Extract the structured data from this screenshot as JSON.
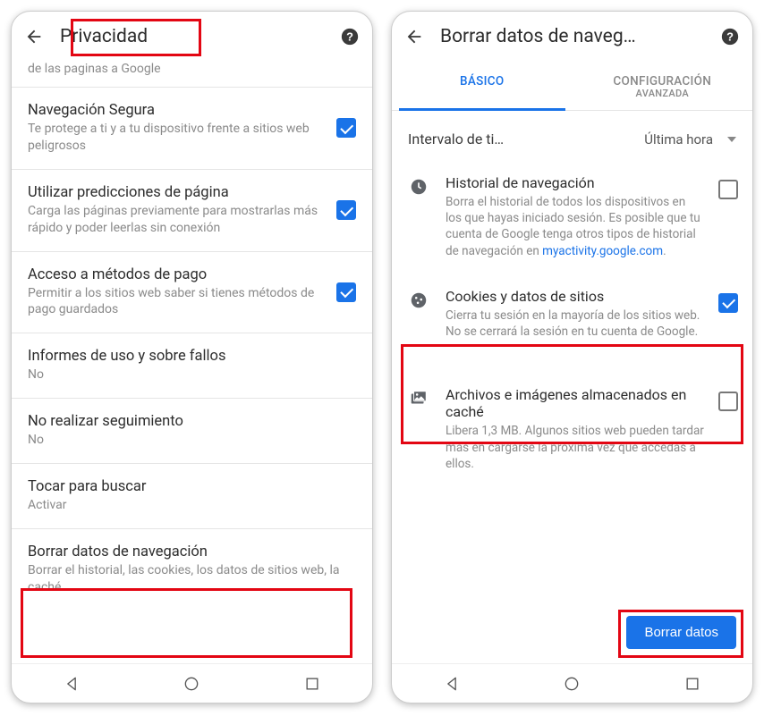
{
  "left": {
    "title": "Privacidad",
    "faded_text": "de las paginas a Google",
    "items": [
      {
        "title": "Navegación Segura",
        "sub": "Te protege a ti y a tu dispositivo frente a sitios web peligrosos",
        "checked": true
      },
      {
        "title": "Utilizar predicciones de página",
        "sub": "Carga las páginas previamente para mostrarlas más rápido y poder leerlas sin conexión",
        "checked": true
      },
      {
        "title": "Acceso a métodos de pago",
        "sub": "Permitir a los sitios web saber si tienes métodos de pago guardados",
        "checked": true
      },
      {
        "title": "Informes de uso y sobre fallos",
        "sub": "No"
      },
      {
        "title": "No realizar seguimiento",
        "sub": "No"
      },
      {
        "title": "Tocar para buscar",
        "sub": "Activar"
      },
      {
        "title": "Borrar datos de navegación",
        "sub": "Borrar el historial, las cookies, los datos de sitios web, la caché…"
      }
    ]
  },
  "right": {
    "title": "Borrar datos de naveg…",
    "tabs": {
      "basic": "BÁSICO",
      "advanced_line1": "CONFIGURACIÓN",
      "advanced_line2": "AVANZADA"
    },
    "range_label": "Intervalo de ti…",
    "range_value": "Última hora",
    "rows": [
      {
        "title": "Historial de navegación",
        "sub_pre": "Borra el historial de todos los dispositivos en los que hayas iniciado sesión. Es posible que tu cuenta de Google tenga otros tipos de historial de navegación en ",
        "link": "myactivity.google.com",
        "sub_post": ".",
        "checked": false
      },
      {
        "title": "Cookies y datos de sitios",
        "sub": "Cierra tu sesión en la mayoría de los sitios web. No se cerrará la sesión en tu cuenta de Google.",
        "checked": true
      },
      {
        "title": "Archivos e imágenes almacenados en caché",
        "sub": "Libera 1,3 MB. Algunos sitios web pueden tardar más en cargarse la próxima vez que accedas a ellos.",
        "checked": false
      }
    ],
    "button": "Borrar datos"
  }
}
